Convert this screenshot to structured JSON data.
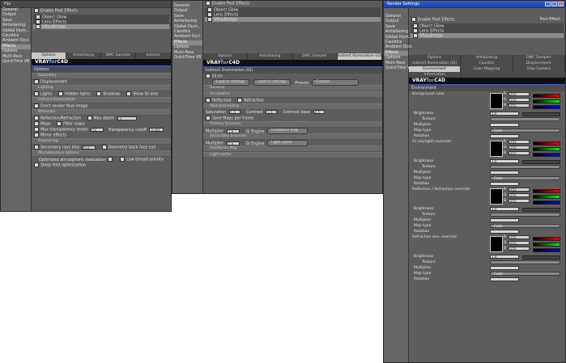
{
  "win1": {
    "title": "File",
    "sidebar": [
      "General",
      "Output",
      "Save",
      "Antialiasing",
      "Global Illum...",
      "Caustics",
      "Ambient Occl.",
      "Effects",
      "Options",
      "Multi-Pass",
      "QuickTime VR"
    ],
    "enable_label": "Enable Post Effects",
    "effects": [
      "Object Glow",
      "Lens Effects",
      "VRayBridge"
    ],
    "tabs": [
      "Options",
      "Antialiasing",
      "DMC Sampler",
      "Indirect"
    ],
    "vray_prefix": "VRAY",
    "vray_for": "for",
    "vray_suffix": "C4D",
    "section": "Options",
    "displacement_sec": "Geometry",
    "displacement": "Displacement",
    "lighting_sec": "Lighting",
    "lights": "Lights",
    "hidden_lights": "Hidden lights",
    "shadows": "Shadows",
    "show_gi": "Show GI only",
    "indirect_sec": "Indirect illumination",
    "dont_render": "Don't render final image",
    "materials_sec": "Materials",
    "refl_refr": "Reflection/Refraction",
    "max_depth": "Max depth",
    "max_depth_val": "5",
    "maps": "Maps",
    "filter_maps": "Filter maps",
    "max_transp": "Max transparency levels",
    "max_transp_val": "50",
    "transp_cutoff": "Transparency cutoff",
    "transp_cutoff_val": "0.001",
    "mirror_effects": "Mirror effects",
    "raytracing_sec": "Raytracing",
    "secondary_rays": "Secondary rays bias",
    "secondary_val": "0.0",
    "geometry_backface": "Geometry back face cull",
    "misc_sec": "Miscellaneous options",
    "optimized": "Optimized atmospheric evaluation",
    "low_thread": "Low thread priority",
    "sleep": "Sleep Hint optimization"
  },
  "win2": {
    "sidebar": [
      "General",
      "Output",
      "Save",
      "Antialiasing",
      "Global Illum...",
      "Caustics",
      "Ambient Occl.",
      "Effects",
      "Options",
      "Multi-Pass",
      "QuickTime VR"
    ],
    "enable_label": "Enable Post Effects",
    "effects": [
      "Object Glow",
      "Lens Effects",
      "VRayBridge"
    ],
    "tabs": [
      "Options",
      "Antialiasing",
      "DMC Sampler",
      "Indirect Illumination (GI)"
    ],
    "vray_prefix": "VRAY",
    "vray_for": "for",
    "vray_suffix": "C4D",
    "section": "Indirect illumination (GI)",
    "gi_on": "GI on",
    "load_btn": "Load irr settings",
    "save_btn": "Load irr settings",
    "presets": "Presets",
    "presets_val": "Custom",
    "general_sec": "General",
    "gi_caustics_sec": "GI caustics",
    "reflective": "Reflective",
    "refractive": "Refractive",
    "post_sec": "Post-processing",
    "saturation": "Saturation",
    "saturation_val": "1.0",
    "contrast": "Contrast",
    "contrast_val": "1.0",
    "contrast_base": "Contrast base",
    "contrast_base_val": "0.5",
    "save_maps": "Save Maps per frame",
    "primary_sec": "Primary bounces",
    "multiplier": "Multiplier",
    "multiplier_val": "1.0",
    "gi_engine": "GI Engine",
    "gi_engine_val": "Irradiance map",
    "secondary_sec": "Secondary bounces",
    "multiplier2": "Multiplier",
    "multiplier2_val": "1.0",
    "gi_engine2": "GI Engine",
    "gi_engine2_val": "Light cache",
    "irr_sec": "Irradiance Map",
    "lightcache_sec": "Light cache"
  },
  "win3": {
    "title": "Render Settings",
    "sidebar": [
      "General",
      "Output",
      "Save",
      "Antialiasing",
      "Global Illum...",
      "Caustics",
      "Ambient Occl.",
      "Effects",
      "Options",
      "Multi-Pass",
      "QuickTime VR"
    ],
    "enable_label": "Enable Post Effects",
    "post_effect": "Post Effect",
    "effects": [
      "Object Glow",
      "Lens Effects",
      "VRayBridge"
    ],
    "tabs_row1": [
      "Options",
      "Antialiasing",
      "DMC Sampler"
    ],
    "tabs_row2": [
      "Indirect Illumination (GI)",
      "Caustics",
      "Displacement"
    ],
    "tabs_row3": [
      "Environment",
      "Color Mapping",
      "Vray Camera"
    ],
    "tabs_row4": [
      "Information"
    ],
    "vray_prefix": "VRAY",
    "vray_for": "for",
    "vray_suffix": "C4D",
    "section": "Environment",
    "blocks": [
      {
        "label": "Background color",
        "r": "255",
        "g": "255",
        "b": "255"
      },
      {
        "label": "GI (skylight) override",
        "r": "255",
        "g": "255",
        "b": "255"
      },
      {
        "label": "Reflection / Refraction override",
        "r": "255",
        "g": "255",
        "b": "255"
      },
      {
        "label": "Refraction env. override",
        "r": "255",
        "g": "255",
        "b": "255"
      }
    ],
    "brightness": "Brightness",
    "texture": "Texture",
    "multiplier": "Multiplier",
    "map_type": "Map type",
    "map_type_val": "Cubic",
    "rotation": "Rotation",
    "brightness_vals": [
      "1.0",
      "1.0",
      "1.0",
      "1.0"
    ]
  },
  "colors": {
    "panel": "#5d5d5d",
    "vray_blue": "#3b59b6",
    "title_blue": "#2a5fd6"
  }
}
